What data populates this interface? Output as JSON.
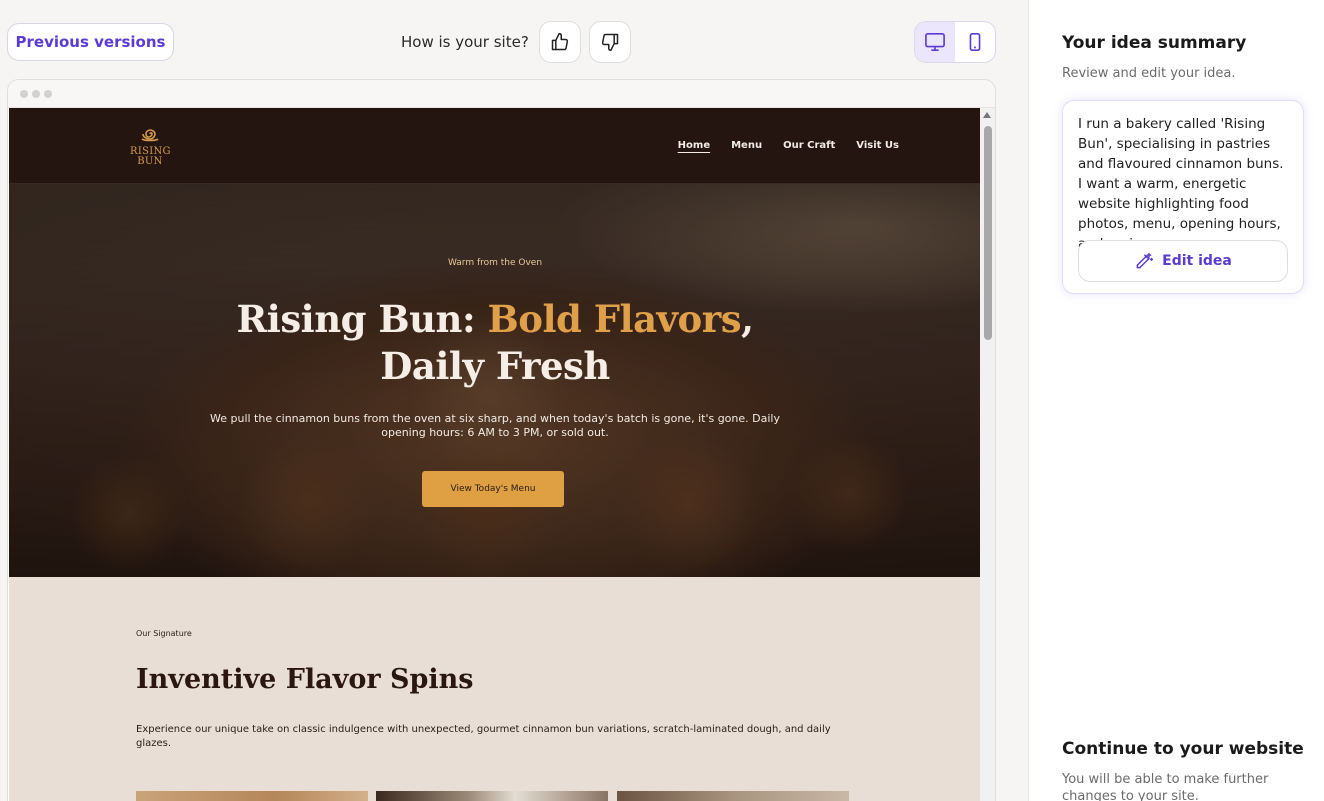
{
  "toolbar": {
    "previous_versions_label": "Previous versions",
    "feedback_question": "How is your site?",
    "thumbs_up_icon": "thumbs-up-icon",
    "thumbs_down_icon": "thumbs-down-icon",
    "view_modes": [
      "desktop",
      "mobile"
    ],
    "active_view": "desktop"
  },
  "site": {
    "logo": {
      "line1": "RISING",
      "line2": "BUN"
    },
    "nav": [
      {
        "label": "Home",
        "active": true
      },
      {
        "label": "Menu",
        "active": false
      },
      {
        "label": "Our Craft",
        "active": false
      },
      {
        "label": "Visit Us",
        "active": false
      }
    ],
    "hero": {
      "eyebrow": "Warm from the Oven",
      "title_part1": "Rising Bun: ",
      "title_accent": "Bold Flavors",
      "title_part2": ",",
      "title_line2": "Daily Fresh",
      "description": "We pull the cinnamon buns from the oven at six sharp, and when today's batch is gone, it's gone. Daily opening hours: 6 AM to 3 PM, or sold out.",
      "cta": "View Today's Menu"
    },
    "signature": {
      "eyebrow": "Our Signature",
      "title": "Inventive Flavor Spins",
      "description": "Experience our unique take on classic indulgence with unexpected, gourmet cinnamon bun variations, scratch-laminated dough, and daily glazes."
    }
  },
  "panel": {
    "title": "Your idea summary",
    "subtitle": "Review and edit your idea.",
    "idea_text": "I run a bakery called 'Rising Bun', specialising in pastries and flavoured cinnamon buns. I want a warm, energetic website highlighting food photos, menu, opening hours, and reviews.",
    "edit_label": "Edit idea",
    "continue_title": "Continue to your website",
    "continue_sub": "You will be able to make further changes to your site."
  },
  "colors": {
    "accent": "#5b3bd1",
    "site_dark": "#241510",
    "hero_accent": "#e0a04a",
    "cta": "#dfa043",
    "section_bg": "#e9ded5"
  }
}
